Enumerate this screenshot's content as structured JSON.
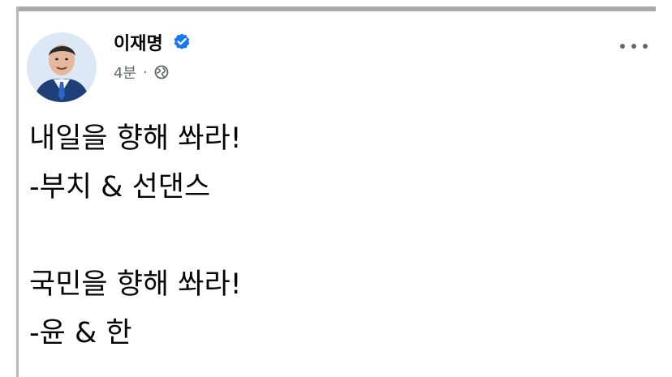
{
  "post": {
    "author_name": "이재명",
    "timestamp": "4분",
    "separator": "·",
    "visibility_icon": "globe-icon",
    "verified_icon": "verified-badge-icon",
    "more_icon": "more-options-icon",
    "avatar_icon": "profile-avatar",
    "body_lines": [
      "내일을 향해 쏴라!",
      "-부치 & 선댄스",
      "국민을 향해 쏴라!",
      "-윤 & 한"
    ]
  },
  "colors": {
    "verified_blue": "#1877f2",
    "meta_gray": "#65676b",
    "text": "#050505"
  }
}
